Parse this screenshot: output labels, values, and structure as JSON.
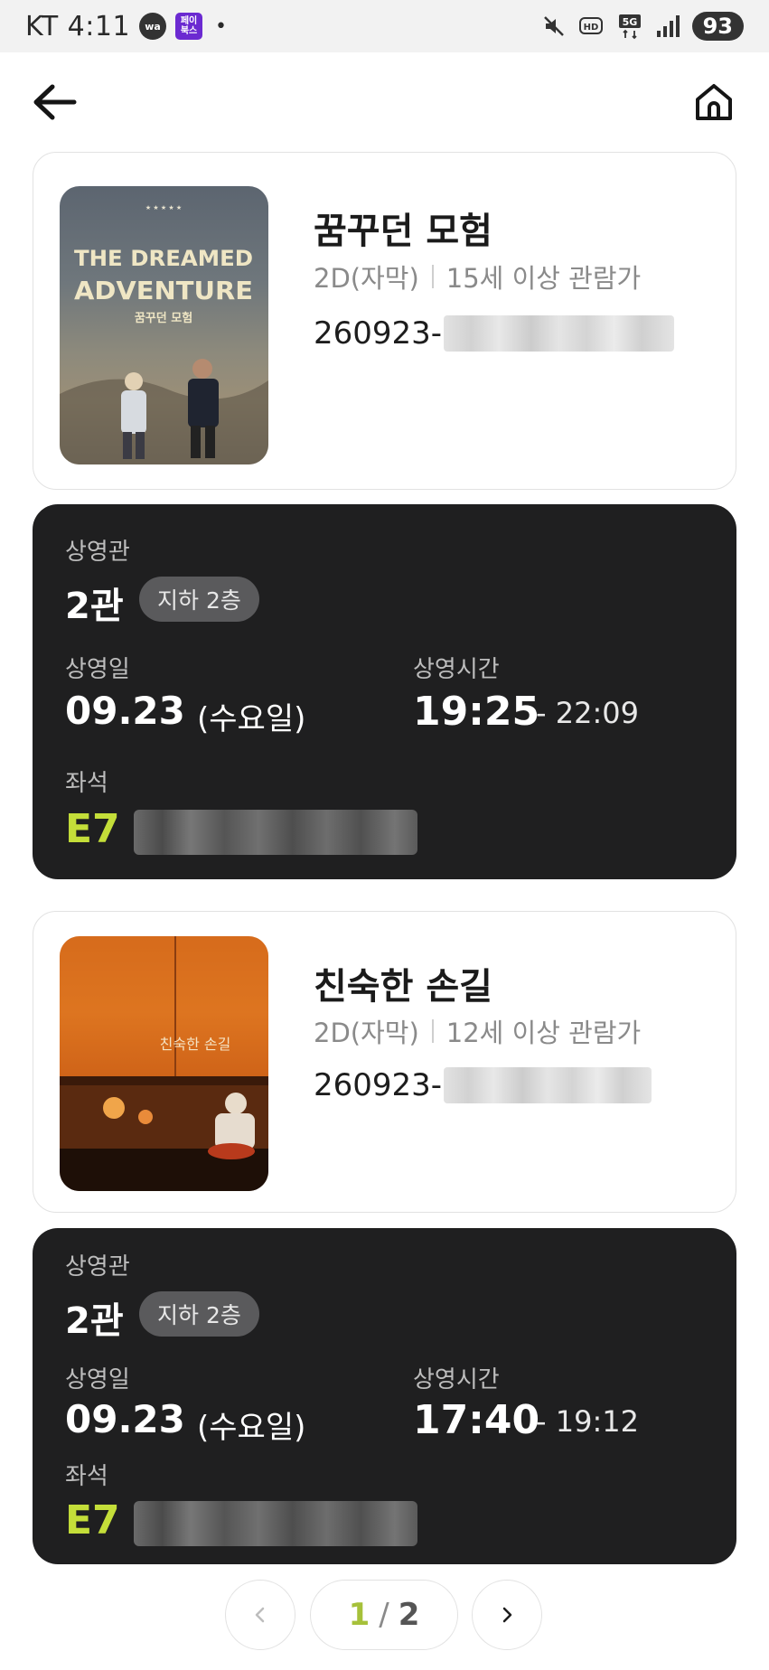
{
  "status_bar": {
    "carrier": "KT",
    "time": "4:11",
    "app_icon_1": "wa",
    "app_icon_2": "페이\n북스",
    "dot": "•",
    "battery": "93",
    "icons": [
      "mute-icon",
      "hd-icon",
      "5g-icon",
      "signal-icon"
    ]
  },
  "nav": {
    "back_icon": "arrow-left-icon",
    "home_icon": "home-icon"
  },
  "tickets": [
    {
      "title": "꿈꾸던 모험",
      "poster_text_line1": "THE DREAMED",
      "poster_text_line2": "ADVENTURE",
      "poster_text_korean": "꿈꾸던 모험",
      "format": "2D(자막)",
      "rating": "15세 이상 관람가",
      "booking_prefix": "260923-",
      "hall_label": "상영관",
      "hall": "2관",
      "floor": "지하 2층",
      "date_label": "상영일",
      "date": "09.23",
      "weekday": "(수요일)",
      "time_label": "상영시간",
      "start_time": "19:25",
      "end_time": "- 22:09",
      "seat_label": "좌석",
      "seat": "E7"
    },
    {
      "title": "친숙한 손길",
      "poster_text_korean": "친숙한 손길",
      "format": "2D(자막)",
      "rating": "12세 이상 관람가",
      "booking_prefix": "260923-",
      "hall_label": "상영관",
      "hall": "2관",
      "floor": "지하 2층",
      "date_label": "상영일",
      "date": "09.23",
      "weekday": "(수요일)",
      "time_label": "상영시간",
      "start_time": "17:40",
      "end_time": "- 19:12",
      "seat_label": "좌석",
      "seat": "E7"
    }
  ],
  "pagination": {
    "current": "1",
    "separator": "/",
    "total": "2",
    "prev_icon": "chevron-left-icon",
    "next_icon": "chevron-right-icon"
  },
  "colors": {
    "accent_seat": "#c4de39",
    "ticket_bg": "#1f1f20",
    "page_current": "#a6c13a"
  }
}
